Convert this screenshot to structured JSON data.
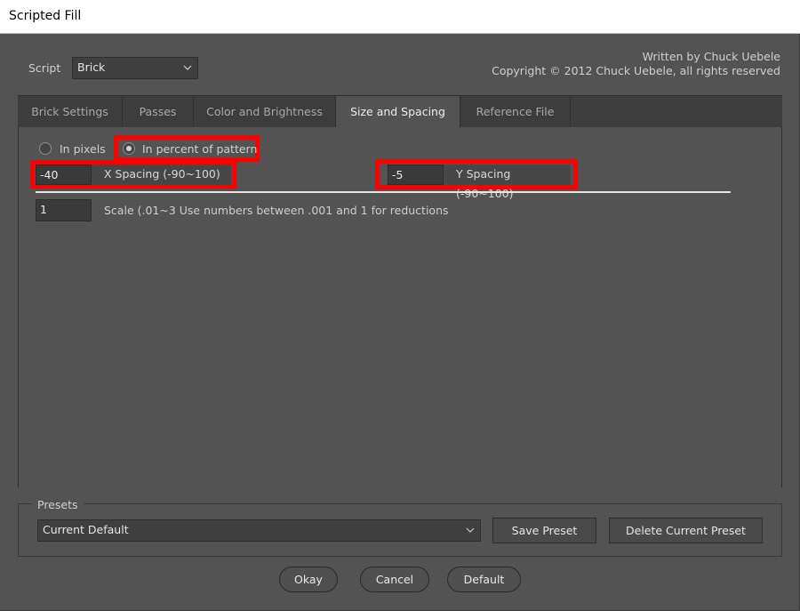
{
  "window": {
    "title": "Scripted Fill"
  },
  "script": {
    "label": "Script",
    "value": "Brick"
  },
  "credit": {
    "line1": "Written by Chuck Uebele",
    "line2": "Copyright © 2012 Chuck Uebele, all rights reserved"
  },
  "tabs": [
    {
      "label": "Brick Settings",
      "active": false
    },
    {
      "label": "Passes",
      "active": false
    },
    {
      "label": "Color and Brightness",
      "active": false
    },
    {
      "label": "Size and Spacing",
      "active": true
    },
    {
      "label": "Reference File",
      "active": false
    }
  ],
  "units": {
    "pixels_label": "In pixels",
    "percent_label": "In percent of pattern",
    "selected": "In percent of pattern"
  },
  "spacing": {
    "x_value": "-40",
    "x_label": "X Spacing (-90~100)",
    "y_value": "-5",
    "y_label": "Y Spacing (-90~100)"
  },
  "scale": {
    "value": "1",
    "label": "Scale (.01~3 Use numbers between .001 and 1 for reductions"
  },
  "presets": {
    "legend": "Presets",
    "selected": "Current Default",
    "save_label": "Save Preset",
    "delete_label": "Delete Current Preset"
  },
  "footer": {
    "okay": "Okay",
    "cancel": "Cancel",
    "default": "Default"
  },
  "colors": {
    "highlight": "#ff0000",
    "panel": "#535353",
    "tabbar": "#3d3d3d"
  }
}
